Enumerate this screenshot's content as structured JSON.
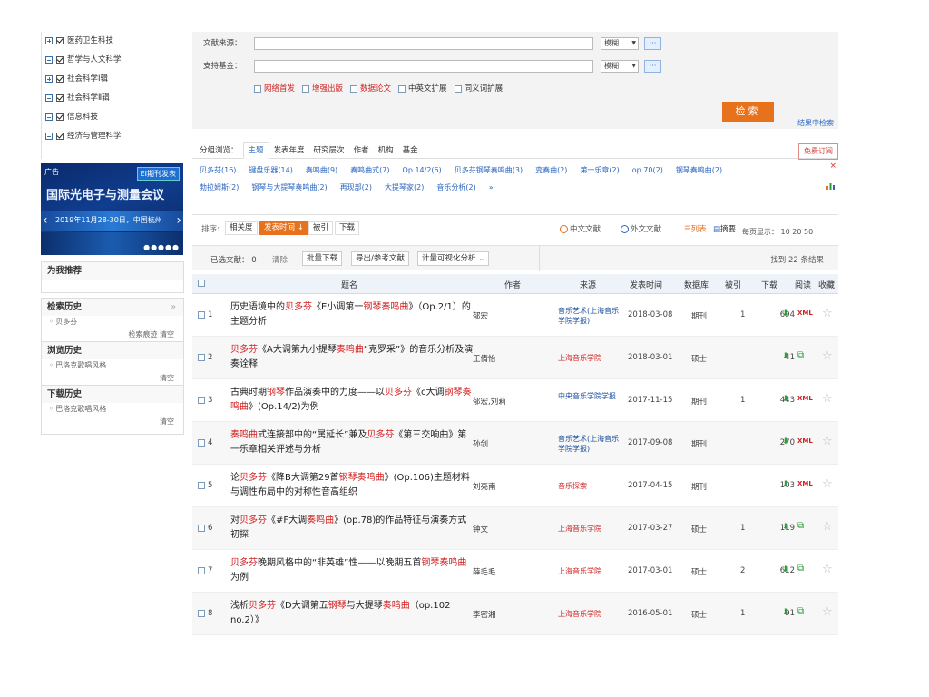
{
  "left": {
    "subjects": [
      {
        "label": "医药卫生科技",
        "expanded": false
      },
      {
        "label": "哲学与人文科学",
        "expanded": true
      },
      {
        "label": "社会科学Ⅰ辑",
        "expanded": false
      },
      {
        "label": "社会科学Ⅱ辑",
        "expanded": true
      },
      {
        "label": "信息科技",
        "expanded": true
      },
      {
        "label": "经济与管理科学",
        "expanded": true
      }
    ],
    "ad": {
      "tag": "广告",
      "badge": "EI期刊发表",
      "title": "国际光电子与测量会议",
      "date": "2019年11月28-30日，中国杭州"
    },
    "recommend_title": "为我推荐",
    "history": {
      "search_title": "检索历史",
      "search_item": "贝多芬",
      "search_ops": "检索痕迹   清空",
      "browse_title": "浏览历史",
      "browse_item": "巴洛克歌唱风格",
      "browse_clear": "清空",
      "download_title": "下载历史",
      "download_item": "巴洛克歌唱风格",
      "download_clear": "清空"
    }
  },
  "search": {
    "source_label": "文献来源：",
    "fund_label": "支持基金：",
    "match1": "模糊",
    "match2": "模糊",
    "more": "···",
    "options": [
      {
        "label": "网络首发",
        "red": true
      },
      {
        "label": "增强出版",
        "red": true
      },
      {
        "label": "数据论文",
        "red": true
      },
      {
        "label": "中英文扩展",
        "red": false
      },
      {
        "label": "同义词扩展",
        "red": false
      }
    ],
    "button": "检索",
    "result_search": "结果中检索"
  },
  "grouping": {
    "label": "分组浏览：",
    "tabs": [
      "主题",
      "发表年度",
      "研究层次",
      "作者",
      "机构",
      "基金"
    ],
    "active": "主题",
    "free_sub": "免费订阅"
  },
  "facets": {
    "row1": [
      "贝多芬(16)",
      "键盘乐器(14)",
      "奏鸣曲(9)",
      "奏鸣曲式(7)",
      "Op.14/2(6)",
      "贝多芬钢琴奏鸣曲(3)",
      "变奏曲(2)",
      "第一乐章(2)",
      "op.70(2)",
      "钢琴奏鸣曲(2)"
    ],
    "row2": [
      "勃拉姆斯(2)",
      "钢琴与大提琴奏鸣曲(2)",
      "再现部(2)",
      "大提琴家(2)",
      "音乐分析(2)",
      "»"
    ],
    "close": "×",
    "chart_icon": "bar-chart-icon"
  },
  "sort": {
    "label": "排序:",
    "buttons": [
      "相关度",
      "发表时间",
      "被引",
      "下载"
    ],
    "active": "发表时间",
    "lang_cn": "中文文献",
    "lang_en": "外文文献",
    "view_list": "列表",
    "view_abstract": "摘要",
    "per_page": "每页显示： 10  20  50"
  },
  "selection": {
    "selected": "已选文献： 0",
    "clear": "清除",
    "bulk_download": "批量下载",
    "export": "导出/参考文献",
    "viz": "计量可视化分析",
    "found": "找到 22 条结果"
  },
  "table": {
    "headers": {
      "title": "题名",
      "author": "作者",
      "source": "来源",
      "date": "发表时间",
      "db": "数据库",
      "cite": "被引",
      "dl": "下载",
      "read": "阅读",
      "fav": "收藏"
    },
    "rows": [
      {
        "no": "1",
        "title": "历史语境中的贝多芬《E小调第一钢琴奏鸣曲》（Op.2/1）的主题分析",
        "author": "郁宏",
        "source": "音乐艺术(上海音乐学院学报)",
        "date": "2018-03-08",
        "db": "期刊",
        "cite": "1",
        "dl": "694",
        "read": "XML"
      },
      {
        "no": "2",
        "title": "贝多芬《A大调第九小提琴奏鸣曲“克罗采”》的音乐分析及演奏诠释",
        "author": "王倩怡",
        "source": "上海音乐学院",
        "date": "2018-03-01",
        "db": "硕士",
        "cite": "",
        "dl": "41",
        "read": "book"
      },
      {
        "no": "3",
        "title": "古典时期钢琴作品演奏中的力度——以贝多芬《c大调钢琴奏鸣曲》(Op.14/2)为例",
        "author": "郁宏,刘莉",
        "source": "中央音乐学院学报",
        "date": "2017-11-15",
        "db": "期刊",
        "cite": "1",
        "dl": "443",
        "read": "XML"
      },
      {
        "no": "4",
        "title": "奏鸣曲式连接部中的“属延长”兼及贝多芬《第三交响曲》第一乐章相关评述与分析",
        "author": "孙剑",
        "source": "音乐艺术(上海音乐学院学报)",
        "date": "2017-09-08",
        "db": "期刊",
        "cite": "",
        "dl": "270",
        "read": "XML"
      },
      {
        "no": "5",
        "title": "论贝多芬《降B大调第29首钢琴奏鸣曲》(Op.106)主题材料与调性布局中的对称性音高组织",
        "author": "刘亮南",
        "source": "音乐探索",
        "date": "2017-04-15",
        "db": "期刊",
        "cite": "",
        "dl": "103",
        "read": "XML"
      },
      {
        "no": "6",
        "title": "对贝多芬《#F大调奏鸣曲》(op.78)的作品特征与演奏方式初探",
        "author": "钟文",
        "source": "上海音乐学院",
        "date": "2017-03-27",
        "db": "硕士",
        "cite": "1",
        "dl": "119",
        "read": "book"
      },
      {
        "no": "7",
        "title": "贝多芬晚期风格中的“非英雄”性——以晚期五首钢琴奏鸣曲为例",
        "author": "薛毛毛",
        "source": "上海音乐学院",
        "date": "2017-03-01",
        "db": "硕士",
        "cite": "2",
        "dl": "612",
        "read": "book"
      },
      {
        "no": "8",
        "title": "浅析贝多芬《D大调第五钢琴与大提琴奏鸣曲（op.102 no.2）》",
        "author": "李密湘",
        "source": "上海音乐学院",
        "date": "2016-05-01",
        "db": "硕士",
        "cite": "1",
        "dl": "91",
        "read": "book"
      }
    ]
  }
}
